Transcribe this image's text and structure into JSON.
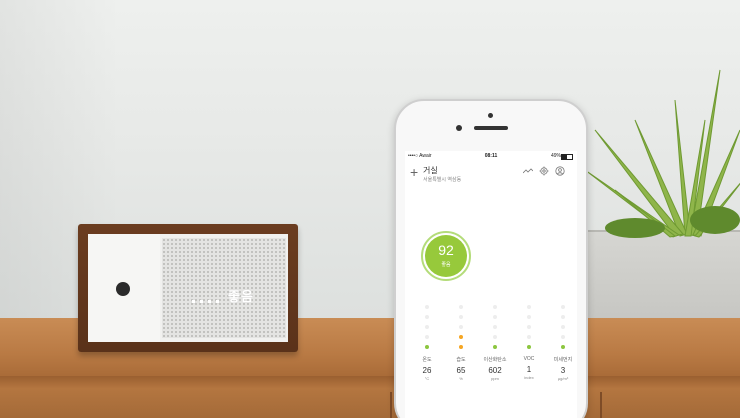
{
  "scene": {
    "device_display": "...",
    "device_word": "좋음"
  },
  "phone": {
    "status": {
      "carrier": "••••○ Awair",
      "time": "08:11",
      "battery": "49%"
    },
    "header": {
      "room": "거실",
      "location": "서울특별시 역삼동"
    },
    "score": {
      "value": "92",
      "label": "좋음"
    },
    "metrics": [
      {
        "label": "온도",
        "value": "26",
        "unit": "°C",
        "level": 1,
        "color": "green"
      },
      {
        "label": "습도",
        "value": "65",
        "unit": "%",
        "level": 2,
        "color": "orange"
      },
      {
        "label": "이산화탄소",
        "value": "602",
        "unit": "ppm",
        "level": 1,
        "color": "green"
      },
      {
        "label": "VOC",
        "value": "1",
        "unit": "index",
        "level": 1,
        "color": "green"
      },
      {
        "label": "미세먼지",
        "value": "3",
        "unit": "µg/m³",
        "level": 1,
        "color": "green"
      }
    ],
    "icons": [
      "add-icon",
      "trend-icon",
      "settings-icon",
      "profile-icon"
    ]
  }
}
